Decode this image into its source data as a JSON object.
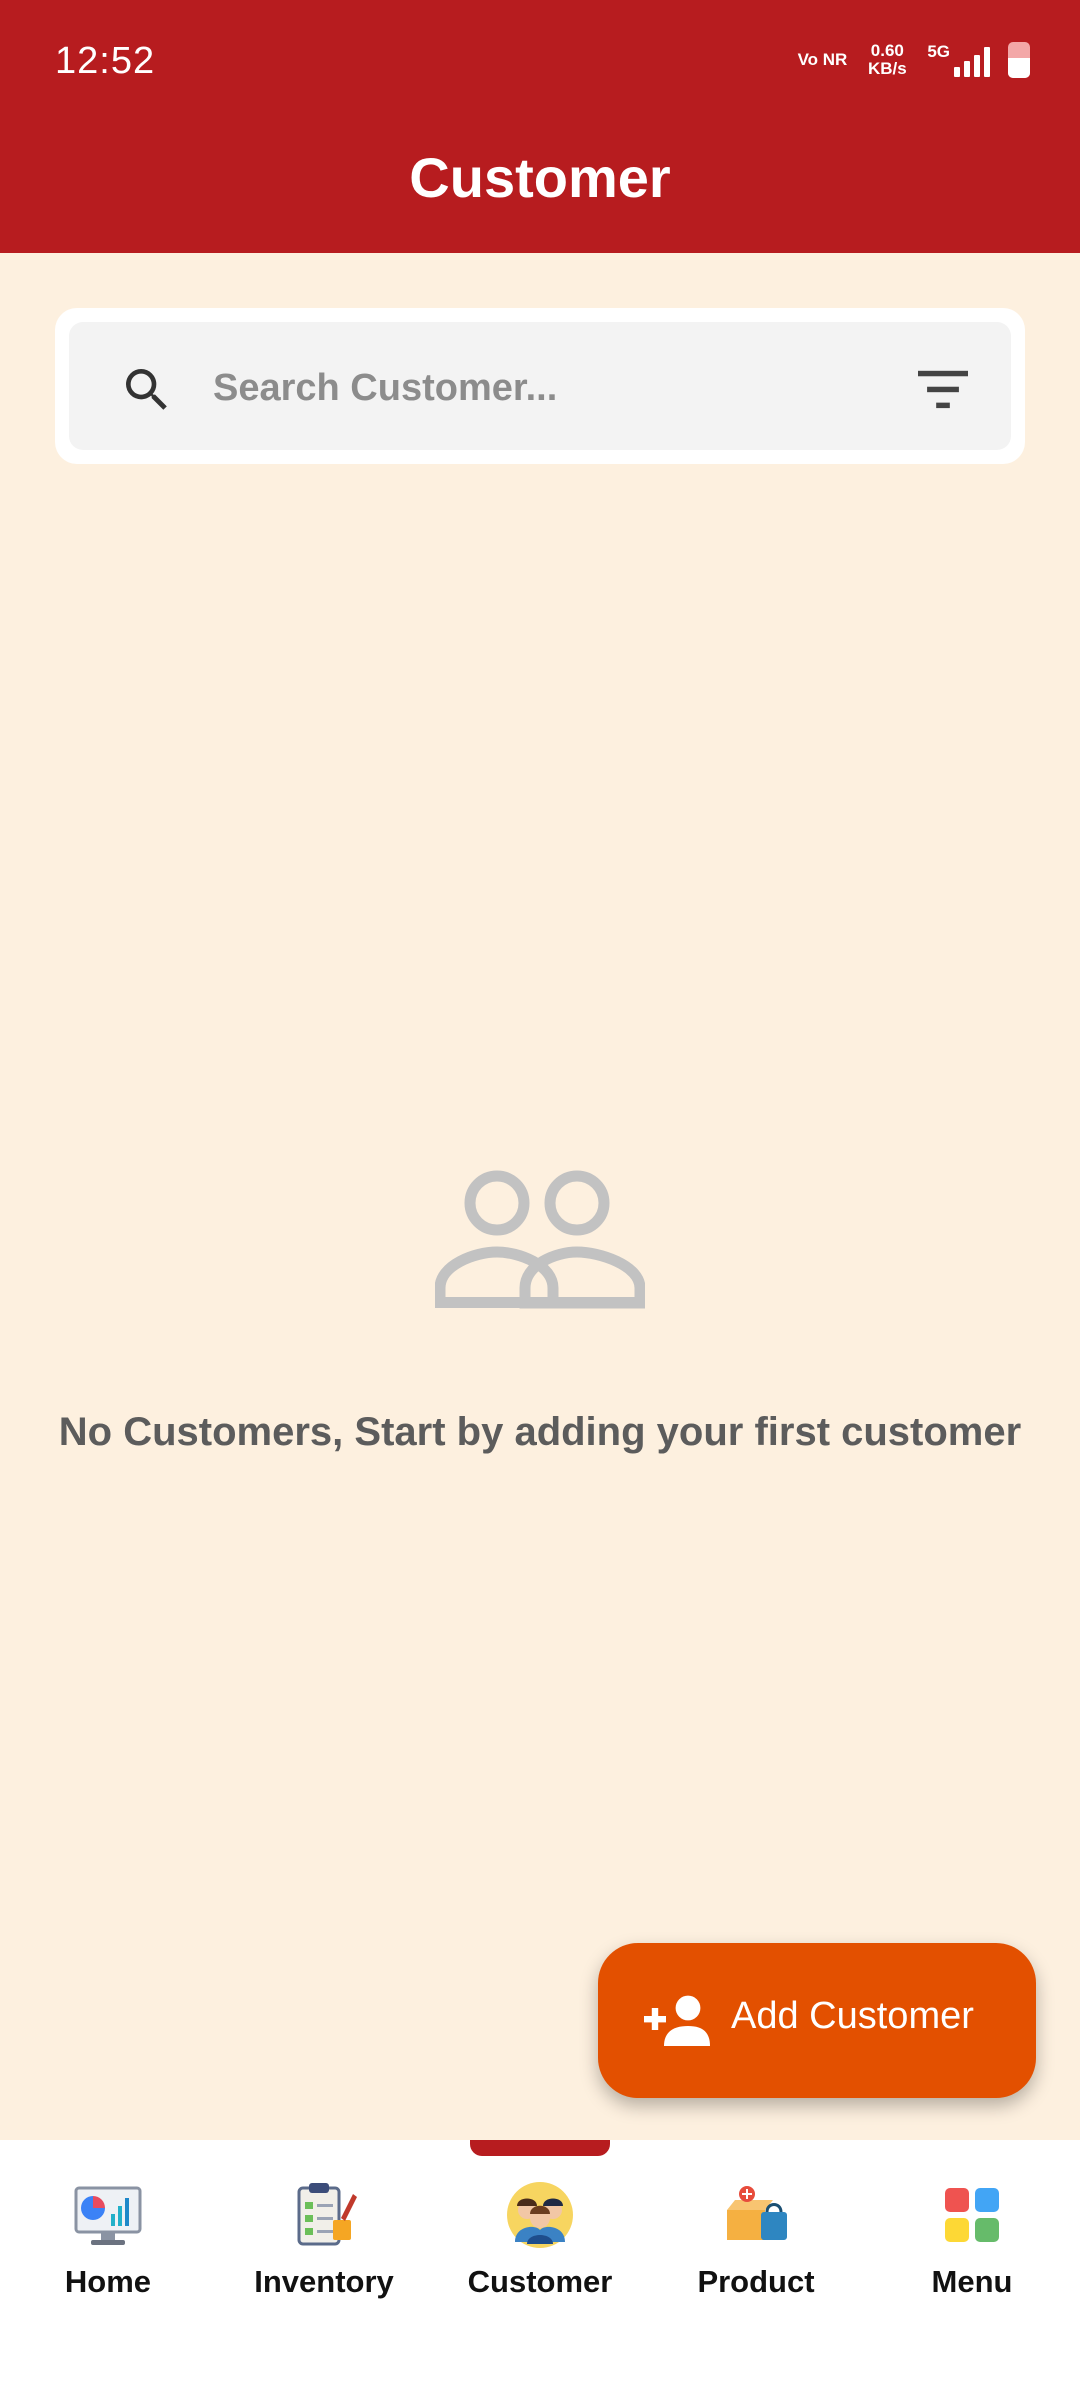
{
  "status_bar": {
    "time": "12:52",
    "network_type": "Vo NR",
    "speed": "0.60 KB/s",
    "generation": "5G"
  },
  "header": {
    "title": "Customer"
  },
  "search": {
    "placeholder": "Search Customer..."
  },
  "empty_state": {
    "message": "No Customers, Start by adding your first customer"
  },
  "fab": {
    "label": "Add Customer"
  },
  "nav": {
    "items": [
      {
        "label": "Home",
        "icon": "dashboard-icon"
      },
      {
        "label": "Inventory",
        "icon": "clipboard-icon"
      },
      {
        "label": "Customer",
        "icon": "customers-icon",
        "active": true
      },
      {
        "label": "Product",
        "icon": "product-box-icon"
      },
      {
        "label": "Menu",
        "icon": "grid-menu-icon"
      }
    ]
  },
  "colors": {
    "header": "#b71c1f",
    "background": "#fdf0df",
    "fab": "#e35000"
  }
}
